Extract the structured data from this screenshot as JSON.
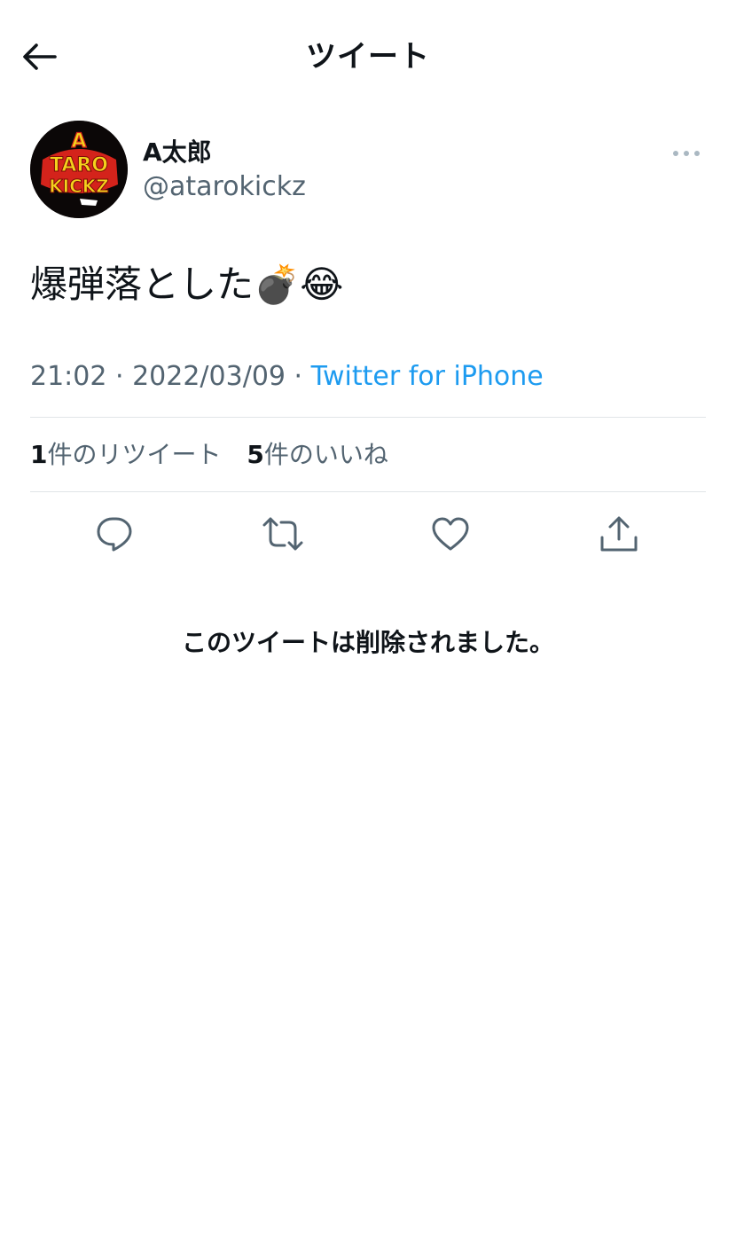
{
  "header": {
    "back_icon": "arrow-left-icon",
    "title": "ツイート"
  },
  "author": {
    "display_name": "A太郎",
    "handle": "@atarokickz",
    "avatar_logo_text": "A TARO KICKZ",
    "more_icon": "ellipsis-icon"
  },
  "tweet": {
    "text": "爆弾落とした💣😂"
  },
  "meta": {
    "time": "21:02",
    "separator": " · ",
    "date": "2022/03/09",
    "source": "Twitter for iPhone"
  },
  "stats": {
    "retweets_count": "1",
    "retweets_label": "件のリツイート",
    "likes_count": "5",
    "likes_label": "件のいいね"
  },
  "actions": [
    "reply-icon",
    "retweet-icon",
    "like-icon",
    "share-icon"
  ],
  "notice": {
    "deleted_message": "このツイートは削除されました。"
  },
  "colors": {
    "text": "#0f1419",
    "secondary": "#536471",
    "link": "#1d9bf0",
    "divider": "#e1e5e8",
    "avatar_yellow": "#f4d21c",
    "avatar_red": "#d4231b"
  }
}
